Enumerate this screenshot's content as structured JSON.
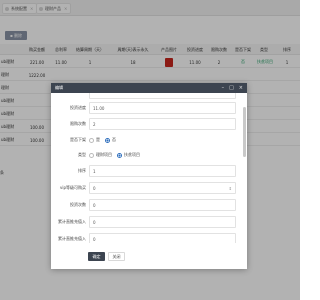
{
  "tabs": [
    {
      "label": "系统配置"
    },
    {
      "label": "理财产品"
    }
  ],
  "toolbar": {
    "delete_label": "删除"
  },
  "table": {
    "headers": [
      "购买金额",
      "总利率",
      "结算周期（天）",
      "周期(天)表示永久",
      "产品图片",
      "投资进度",
      "限购次数",
      "是否下架",
      "类型",
      "排序"
    ],
    "rows": [
      {
        "name": "ub理财",
        "amount": "221.00",
        "rate": "11.00",
        "settle": "1",
        "period": "18",
        "progress": "11.00",
        "limit": "2",
        "offline": "否",
        "type": "扶贫项目",
        "sort": "1"
      },
      {
        "name": "理财",
        "amount": "1222.00"
      },
      {
        "name": "理财",
        "amount": ""
      },
      {
        "name": "ub理财",
        "amount": ""
      },
      {
        "name": "ub理财",
        "amount": ""
      },
      {
        "name": "ub理财",
        "amount": "100.00"
      },
      {
        "name": "ub理财",
        "amount": "100.00"
      }
    ],
    "tail_text": "条"
  },
  "modal": {
    "title": "编辑",
    "fields": {
      "progress": {
        "label": "投资进度",
        "value": "11.00"
      },
      "limit": {
        "label": "限购次数",
        "value": "2"
      },
      "offline": {
        "label": "是否下架",
        "options": [
          "是",
          "否"
        ],
        "selected": 1
      },
      "type": {
        "label": "类型",
        "options": [
          "理财项目",
          "扶贫项目"
        ],
        "selected": 1
      },
      "sort": {
        "label": "排序",
        "value": "1"
      },
      "vip": {
        "label": "vip等级可购买",
        "value": "0"
      },
      "invest_count": {
        "label": "投资次数",
        "value": "0"
      },
      "total_earn": {
        "label": "累计直推充值入",
        "value": "0"
      },
      "total_earn2": {
        "label": "累计直推充值入",
        "value": "0"
      }
    },
    "ok_label": "确定",
    "close_label": "关闭"
  },
  "colors": {
    "modal_header": "#3c4450",
    "accent_blue": "#2f6fbd",
    "green": "#2aa26b",
    "product_red": "#c8261e"
  }
}
